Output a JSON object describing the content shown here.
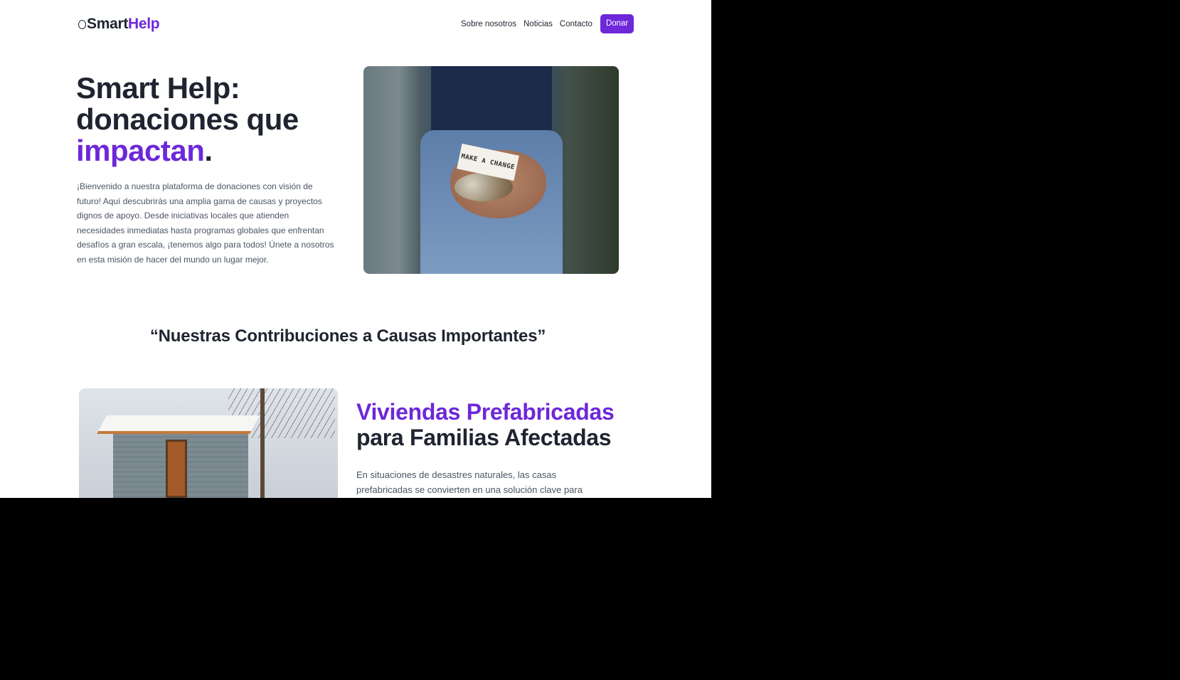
{
  "header": {
    "logo_smart": "Smart",
    "logo_help": "Help",
    "nav": [
      "Sobre nosotros",
      "Noticias",
      "Contacto"
    ],
    "donate_label": "Donar"
  },
  "hero": {
    "title_line1": "Smart Help:",
    "title_line2": "donaciones que",
    "title_accent": "impactan",
    "title_end": ".",
    "body": "¡Bienvenido a nuestra plataforma de donaciones con visión de futuro! Aquí descubrirás una amplia gama de causas y proyectos dignos de apoyo. Desde iniciativas locales que atienden necesidades inmediatas hasta programas globales que enfrentan desafíos a gran escala, ¡tenemos algo para todos! Únete a nosotros en esta misión de hacer del mundo un lugar mejor.",
    "photo_note": "MAKE A CHANGE"
  },
  "section": {
    "title": "“Nuestras Contribuciones a Causas Importantes”"
  },
  "card": {
    "title_accent": "Viviendas Prefabricadas",
    "title_rest": "para Familias Afectadas",
    "body": "En situaciones de desastres naturales, las casas prefabricadas se convierten en una solución clave para brindar refugio rápido"
  },
  "colors": {
    "accent": "#6d28d9",
    "heading": "#1f2430",
    "body_text": "#4b5563"
  },
  "icons": {
    "logo": "ring-logo-icon"
  }
}
